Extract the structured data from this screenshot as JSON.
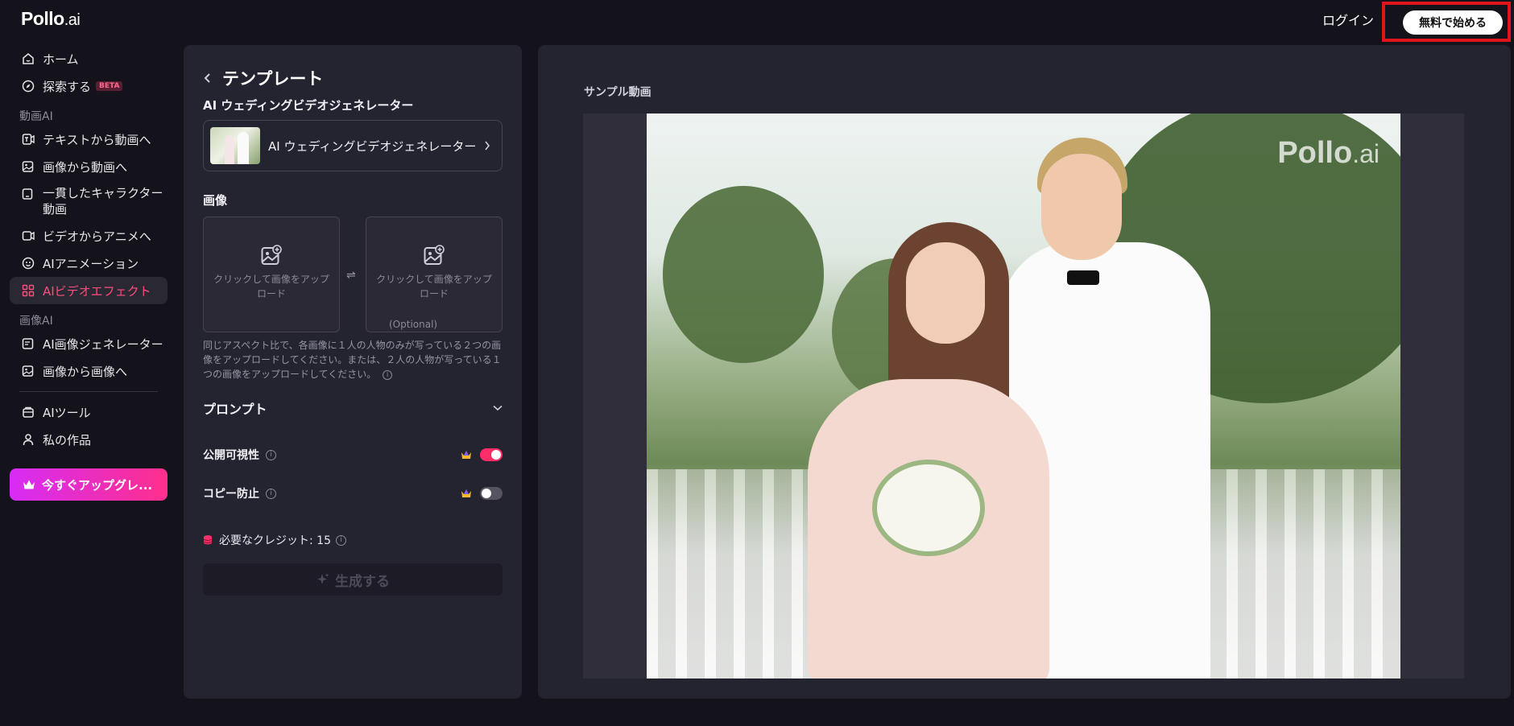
{
  "header": {
    "logo_main": "Pollo",
    "logo_suffix": ".ai",
    "login_label": "ログイン",
    "start_free_label": "無料で始める"
  },
  "sidebar": {
    "home": "ホーム",
    "explore": "探索する",
    "explore_badge": "BETA",
    "video_ai_section": "動画AI",
    "text_to_video": "テキストから動画へ",
    "image_to_video": "画像から動画へ",
    "consistent_character_line1": "一貫したキャラクター",
    "consistent_character_line2": "動画",
    "video_to_anime": "ビデオからアニメへ",
    "ai_animation": "AIアニメーション",
    "ai_video_effects": "AIビデオエフェクト",
    "image_ai_section": "画像AI",
    "ai_image_generator": "AI画像ジェネレーター",
    "image_to_image": "画像から画像へ",
    "ai_tools": "AIツール",
    "my_works": "私の作品",
    "upgrade_label": "今すぐアップグレ..."
  },
  "panel": {
    "title": "テンプレート",
    "template_section_label": "AI ウェディングビデオジェネレーター",
    "template_card_name": "AI ウェディングビデオジェネレーター",
    "image_section_label": "画像",
    "upload1_text": "クリックして画像をアップロード",
    "upload2_text": "クリックして画像をアップロード",
    "upload2_optional": "(Optional)",
    "hint": "同じアスペクト比で、各画像に１人の人物のみが写っている２つの画像をアップロードしてください。または、２人の人物が写っている１つの画像をアップロードしてください。",
    "prompt_label": "プロンプト",
    "public_visibility_label": "公開可視性",
    "public_visibility_on": true,
    "copy_protection_label": "コピー防止",
    "copy_protection_on": false,
    "credits_label": "必要なクレジット: 15",
    "generate_label": "生成する"
  },
  "preview": {
    "title": "サンプル動画",
    "watermark_main": "Pollo",
    "watermark_suffix": ".ai"
  },
  "colors": {
    "accent_pink": "#ff2d67",
    "active_text": "#ff4d7d",
    "upgrade_gradient_start": "#d62cf5",
    "upgrade_gradient_end": "#ff2f8c",
    "highlight_border": "#e0141b"
  },
  "icons": [
    "home-icon",
    "compass-icon",
    "text-video-icon",
    "image-video-icon",
    "character-icon",
    "anime-icon",
    "animation-icon",
    "effects-icon",
    "image-generator-icon",
    "image-to-image-icon",
    "tools-icon",
    "user-icon",
    "crown-icon",
    "image-add-icon",
    "swap-icon",
    "chevron-down-icon",
    "info-icon",
    "coin-icon",
    "sparkle-icon"
  ]
}
